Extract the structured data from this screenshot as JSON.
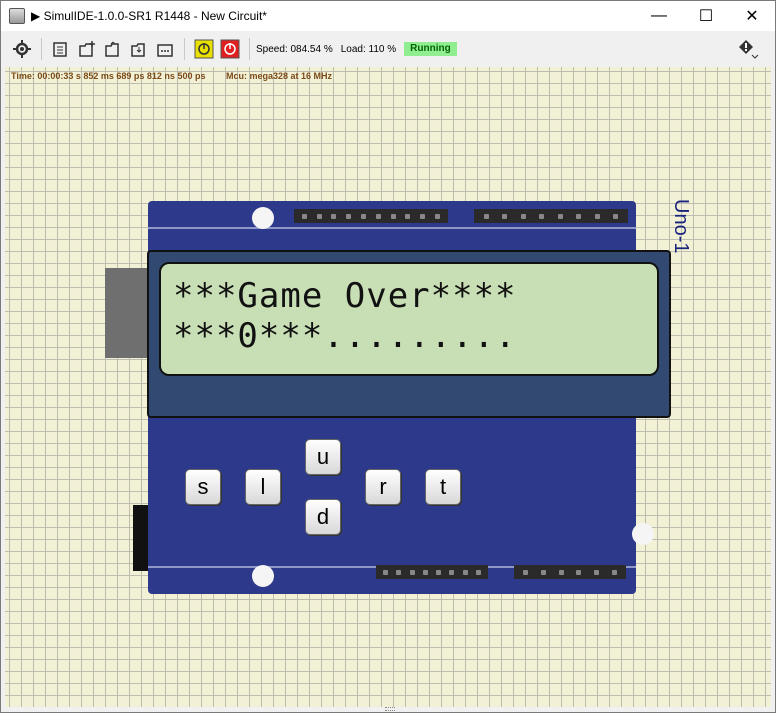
{
  "window": {
    "title": "▶ SimulIDE-1.0.0-SR1 R1448 - New Circuit*",
    "minimize": "—",
    "maximize": "☐",
    "close": "✕"
  },
  "toolbar": {
    "speed_text": "Speed: 084.54 %",
    "load_text": "Load: 110 %",
    "status": "Running",
    "status_color": "#90ee90"
  },
  "info": {
    "time_text": "Time: 00:00:33 s  852 ms  689 ps  812 ns  500 ps",
    "mcu_text": "Mcu: mega328 at 16 MHz"
  },
  "component": {
    "label": "Uno-1"
  },
  "lcd": {
    "line1": "***Game Over****",
    "line2": "***0***........."
  },
  "keys": {
    "s": "s",
    "l": "l",
    "u": "u",
    "d": "d",
    "r": "r",
    "t": "t"
  },
  "colors": {
    "canvas": "#f2f1d6",
    "board": "#2d3a8c",
    "lcd_bg": "#c8deb4",
    "label": "#1a237e"
  }
}
